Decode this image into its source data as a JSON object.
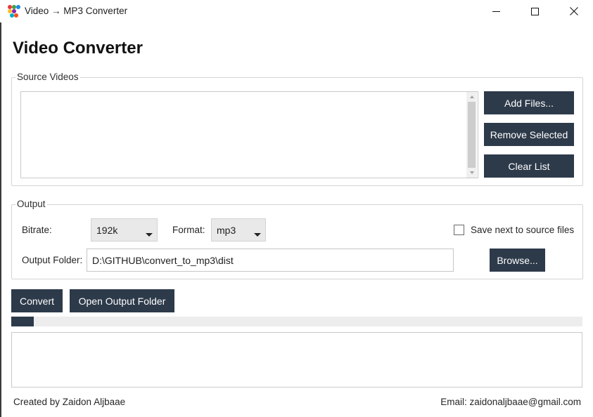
{
  "window": {
    "title": "Video → MP3 Converter",
    "icon": "app-dots-icon",
    "controls": {
      "minimize": "minimize-icon",
      "maximize": "maximize-icon",
      "close": "close-icon"
    }
  },
  "heading": "Video Converter",
  "source": {
    "legend": "Source Videos",
    "files": [],
    "buttons": {
      "add": "Add Files...",
      "remove": "Remove Selected",
      "clear": "Clear List"
    }
  },
  "output": {
    "legend": "Output",
    "bitrate_label": "Bitrate:",
    "bitrate_value": "192k",
    "format_label": "Format:",
    "format_value": "mp3",
    "save_next_label": "Save next to source files",
    "save_next_checked": false,
    "folder_label": "Output Folder:",
    "folder_value": "D:\\GITHUB\\convert_to_mp3\\dist",
    "browse": "Browse..."
  },
  "actions": {
    "convert": "Convert",
    "open_folder": "Open Output Folder"
  },
  "progress": {
    "fraction": 0.04
  },
  "log": "",
  "footer": {
    "credit": "Created by Zaidon Aljbaae",
    "email": "Email: zaidonaljbaae@gmail.com"
  },
  "colors": {
    "button_bg": "#2d3a4a",
    "button_text": "#ffffff",
    "progress_fill": "#2d3a4a",
    "group_border": "#d4d4d4"
  }
}
